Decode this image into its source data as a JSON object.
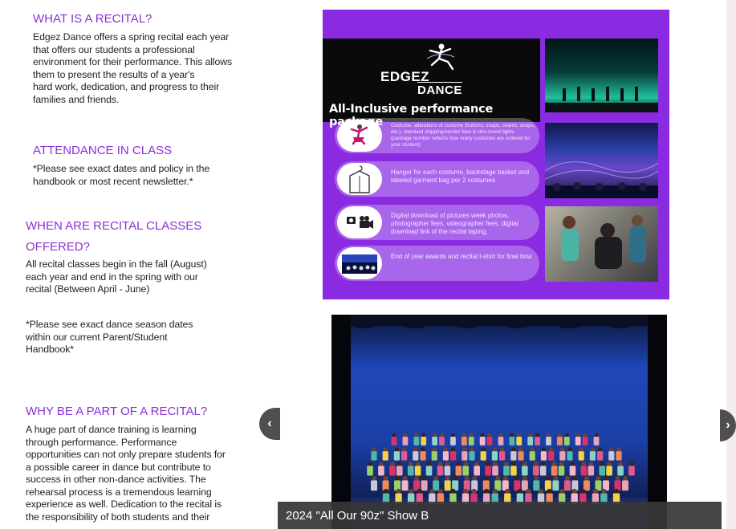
{
  "sections": {
    "recital": {
      "title": "WHAT IS A RECITAL?",
      "lines": [
        "Edgez Dance offers a spring recital each year",
        "that offers our students a professional",
        "environment for their performance. This allows",
        "them to present the results of a year's",
        "hard work, dedication, and progress to their",
        "families and friends."
      ]
    },
    "attendance": {
      "title": "ATTENDANCE IN CLASS",
      "lines": [
        "*Please see exact dates and policy in the",
        "handbook or most recent newsletter.*"
      ]
    },
    "when": {
      "title_line1": "WHEN ARE RECITAL CLASSES",
      "title_line2": "OFFERED?",
      "lines": [
        "All recital classes begin in the fall (August)",
        "each year and end in the spring with our",
        "recital (Between April - June)"
      ],
      "note_lines": [
        "*Please see exact dance season dates",
        "within our current Parent/Student",
        "Handbook*"
      ]
    },
    "why": {
      "title": "WHY BE A PART OF A RECITAL?",
      "lines": [
        "A huge part of dance training is learning",
        "through performance. Performance",
        "opportunities can not only prepare students for",
        "a possible career in dance but contribute to",
        "success in other non-dance activities. The",
        "rehearsal process is a tremendous learning",
        "experience as well. Dedication to the recital is",
        "the responsibility of both students and their"
      ]
    }
  },
  "flyer": {
    "brand_line1": "EDGEZ",
    "brand_line2": "DANCE",
    "subtitle": "All-Inclusive performance package",
    "items": [
      {
        "icon": "dancer-icon",
        "text": "Costume, alterations of costume (buttons, snaps, seams, straps, etc.), standard shipping/vendor fees & skin-toned tights (package number reflects how many costumes are ordered for your student)"
      },
      {
        "icon": "garment-bag-icon",
        "text": "Hanger for each costume, backstage basket and labeled garment bag per 2 costumes"
      },
      {
        "icon": "camera-icon",
        "text": "Digital download of pictures week photos, photographer fees, videographer fees, digital download link of the recital taping,"
      },
      {
        "icon": "awards-photo-icon",
        "text": "End of year awards and recital t-shirt for final bow"
      }
    ],
    "colors": {
      "background": "#8a2be2",
      "header": "#0a0a0a"
    }
  },
  "slideshow": {
    "caption": "2024 \"All Our 90z\" Show B",
    "prev_icon": "chevron-left-icon",
    "next_icon": "chevron-right-icon"
  },
  "colors": {
    "accent": "#8b2fd6",
    "text": "#222222",
    "caption_bg": "#373737"
  }
}
